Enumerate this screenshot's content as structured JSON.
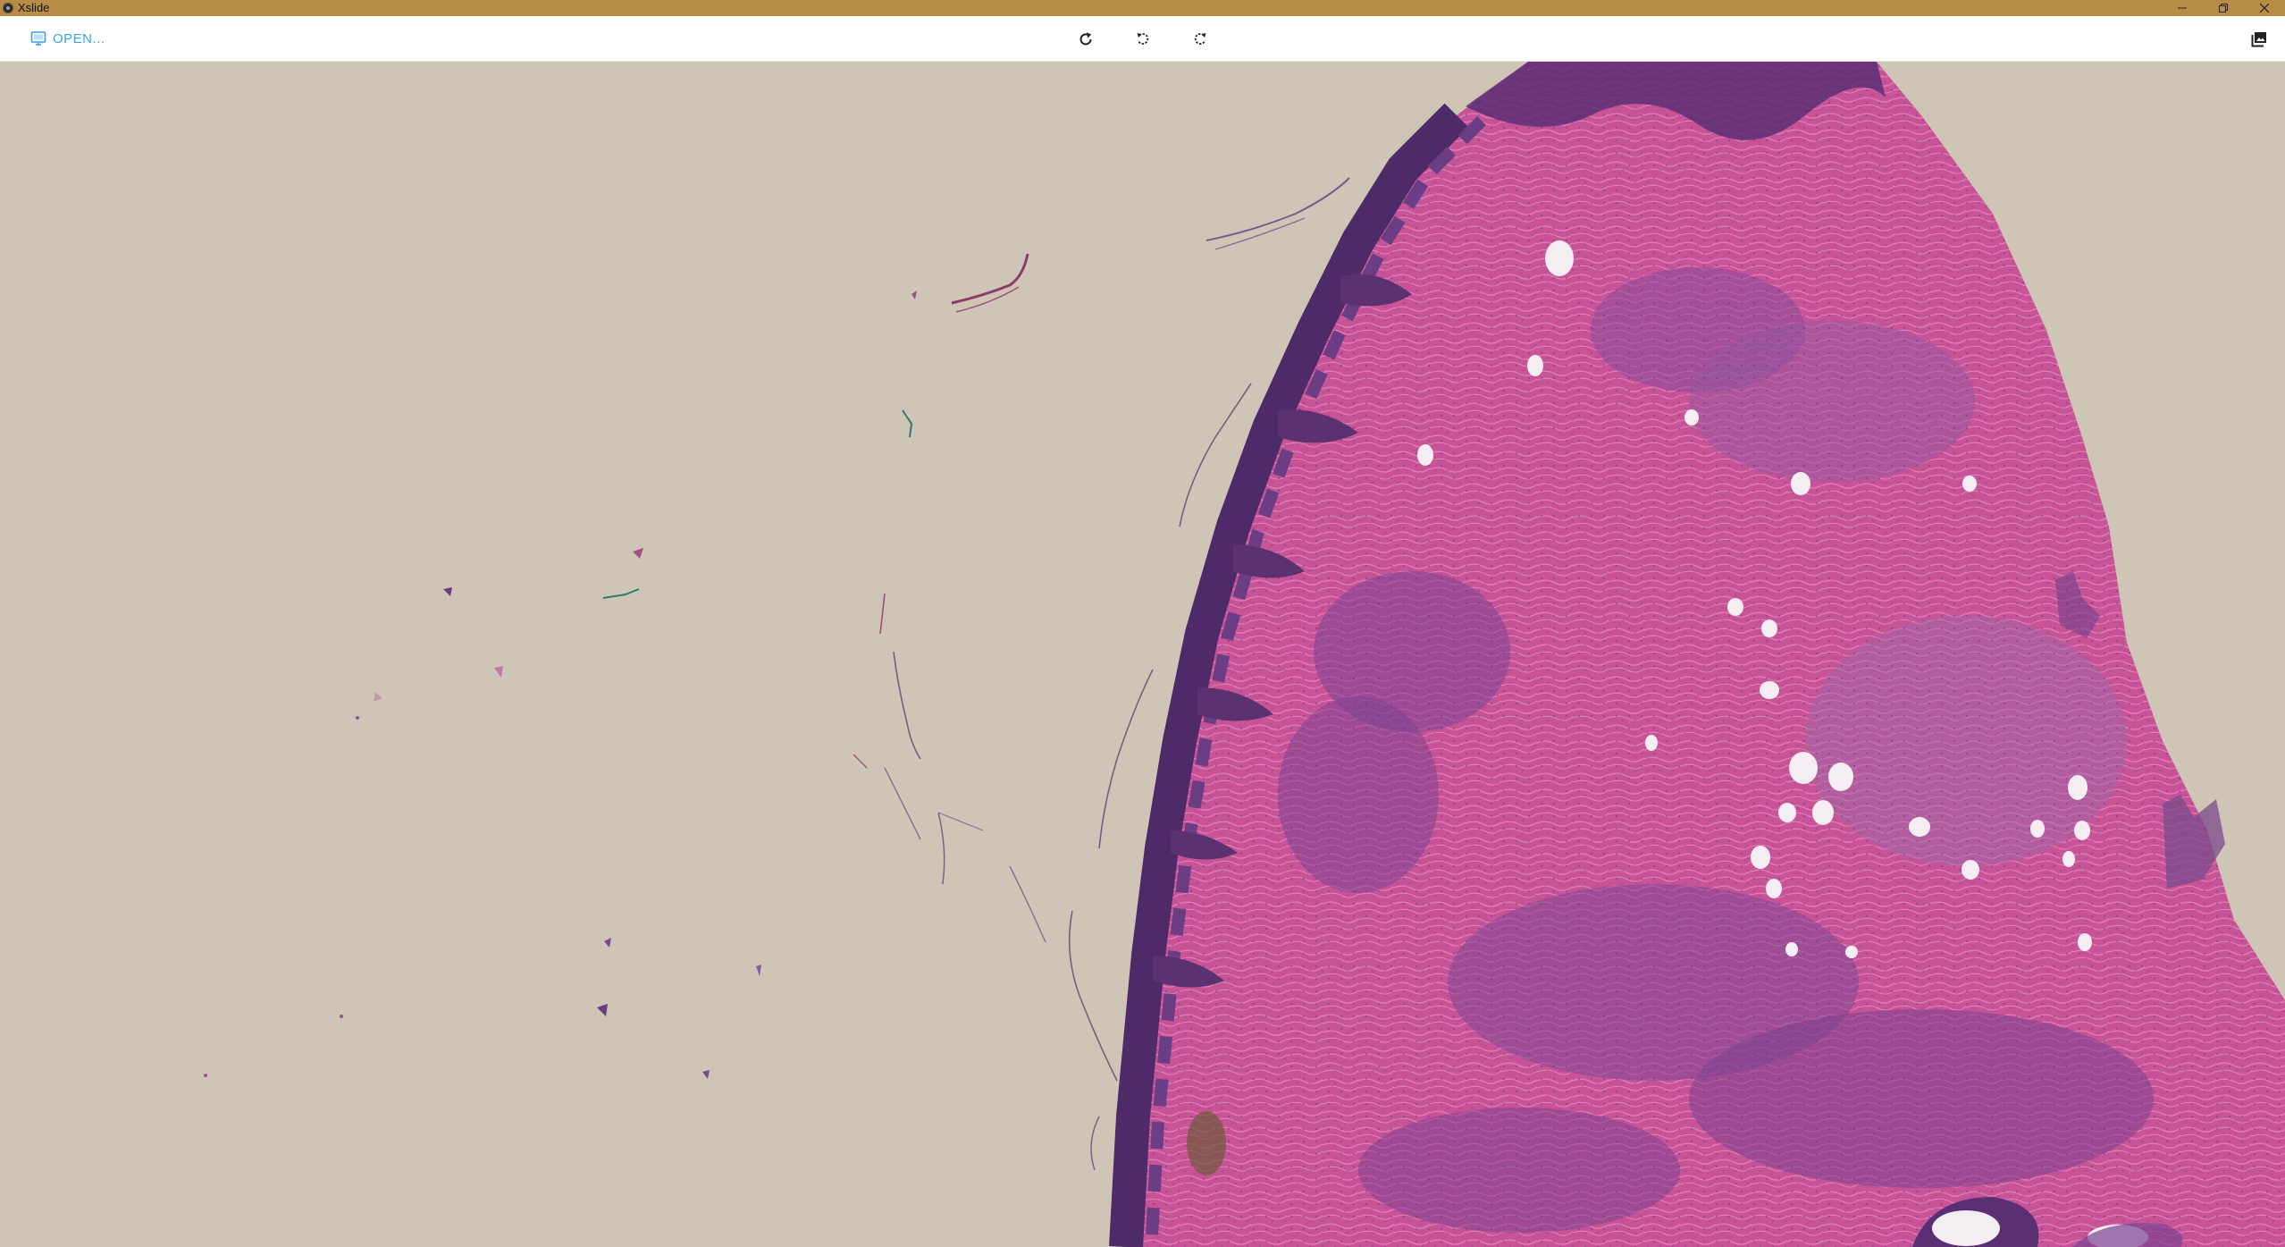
{
  "window": {
    "title": "Xslide",
    "controls": [
      "minimize-icon",
      "restore-icon",
      "close-icon"
    ]
  },
  "toolbar": {
    "open_label": "OPEN...",
    "open_icon": "monitor-icon",
    "tools": [
      {
        "name": "refresh",
        "icon": "refresh-icon"
      },
      {
        "name": "rotate-left",
        "icon": "rotate-left-icon"
      },
      {
        "name": "rotate-right",
        "icon": "rotate-right-icon"
      }
    ],
    "gallery_icon": "image-gallery-icon"
  },
  "colors": {
    "titlebar": "#b88c45",
    "toolbar_bg": "#ffffff",
    "accent": "#3d9fe0",
    "slide_background": "#cfc5b7",
    "tissue_epidermis": "#5a2f73",
    "tissue_dermis": "#c94f95",
    "tissue_light": "#e07ab5"
  }
}
